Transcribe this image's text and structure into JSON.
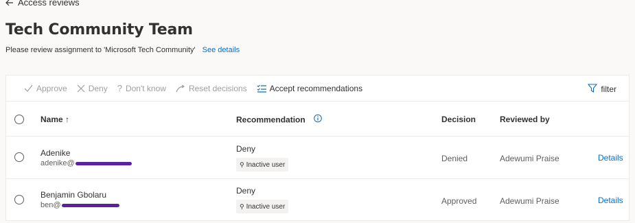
{
  "breadcrumb": {
    "label": "Access reviews"
  },
  "page": {
    "title": "Tech Community Team",
    "subtitle": "Please review assignment to 'Microsoft Tech Community'",
    "see_details": "See details"
  },
  "toolbar": {
    "approve": "Approve",
    "deny": "Deny",
    "dont_know": "Don't know",
    "reset": "Reset decisions",
    "accept": "Accept recommendations",
    "filter": "filter"
  },
  "table": {
    "headers": {
      "name": "Name ↑",
      "recommendation": "Recommendation",
      "decision": "Decision",
      "reviewed_by": "Reviewed by"
    },
    "rows": [
      {
        "name": "Adenike",
        "email_prefix": "adenike@",
        "recommendation": "Deny",
        "tag": "Inactive user",
        "decision": "Denied",
        "reviewed_by": "Adewumi Praise",
        "details": "Details"
      },
      {
        "name": "Benjamin Gbolaru",
        "email_prefix": "ben@",
        "recommendation": "Deny",
        "tag": "Inactive user",
        "decision": "Approved",
        "reviewed_by": "Adewumi Praise",
        "details": "Details"
      }
    ]
  },
  "colors": {
    "link": "#0f6cbd",
    "redaction": "#5c1fa0",
    "disabled": "#a19f9d"
  }
}
